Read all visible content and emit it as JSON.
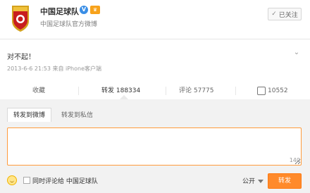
{
  "account": {
    "name": "中国足球队",
    "subtitle": "中国足球队官方微博",
    "follow_label": "已关注"
  },
  "post": {
    "text": "对不起！",
    "meta": "2013-6-6 21:53 来自 iPhone客户端"
  },
  "actions": {
    "collect_label": "收藏",
    "repost_label": "转发 188334",
    "comment_label": "评论 57775",
    "like_count": "10552"
  },
  "compose": {
    "tabs": [
      {
        "label": "转发到微博"
      },
      {
        "label": "转发到私信"
      }
    ],
    "text_value": "",
    "counter": "140",
    "also_comment_label": "同时评论给 中国足球队",
    "scope_label": "公开",
    "submit_label": "转发"
  },
  "colors": {
    "accent": "#ff8a2b",
    "verified": "#3a8ee6",
    "vip": "#f7a21b"
  },
  "icons": {
    "verified": "verified-check-icon",
    "vip": "vip-badge-icon",
    "like": "thumbs-up-icon",
    "more": "chevron-down-icon",
    "emoji": "smile-icon",
    "scope_caret": "caret-down-icon"
  }
}
